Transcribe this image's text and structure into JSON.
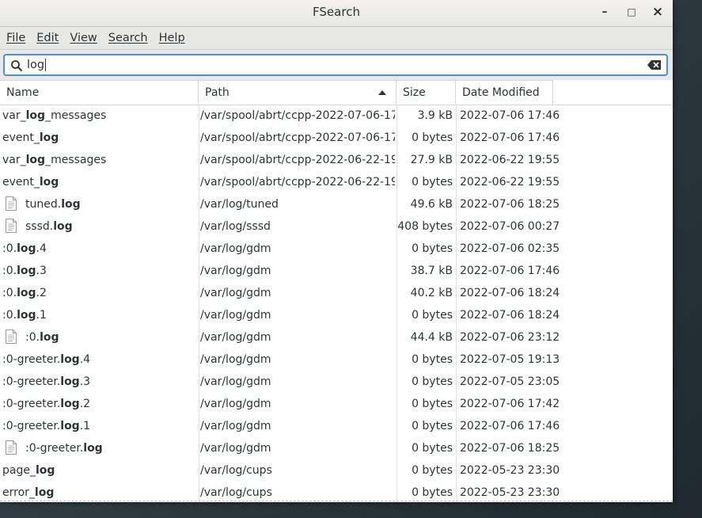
{
  "window": {
    "title": "FSearch",
    "minimize_glyph": "–",
    "maximize_glyph": "□",
    "close_glyph": "×"
  },
  "menu": [
    "File",
    "Edit",
    "View",
    "Search",
    "Help"
  ],
  "search": {
    "value": "log",
    "icon": "search-icon",
    "clear_icon": "clear-icon"
  },
  "columns": [
    "Name",
    "Path",
    "Size",
    "Date Modified"
  ],
  "sort": {
    "column": "Path",
    "direction": "ascending"
  },
  "rows": [
    {
      "icon": false,
      "pre": "var_",
      "match": "log",
      "post": "_messages",
      "path": "/var/spool/abrt/ccpp-2022-07-06-17…",
      "size": "3.9 kB",
      "date": "2022-07-06 17:46"
    },
    {
      "icon": false,
      "pre": "event_",
      "match": "log",
      "post": "",
      "path": "/var/spool/abrt/ccpp-2022-07-06-17…",
      "size": "0 bytes",
      "date": "2022-07-06 17:46"
    },
    {
      "icon": false,
      "pre": "var_",
      "match": "log",
      "post": "_messages",
      "path": "/var/spool/abrt/ccpp-2022-06-22-19…",
      "size": "27.9 kB",
      "date": "2022-06-22 19:55"
    },
    {
      "icon": false,
      "pre": "event_",
      "match": "log",
      "post": "",
      "path": "/var/spool/abrt/ccpp-2022-06-22-19…",
      "size": "0 bytes",
      "date": "2022-06-22 19:55"
    },
    {
      "icon": true,
      "pre": "tuned.",
      "match": "log",
      "post": "",
      "path": "/var/log/tuned",
      "size": "49.6 kB",
      "date": "2022-07-06 18:25"
    },
    {
      "icon": true,
      "pre": "sssd.",
      "match": "log",
      "post": "",
      "path": "/var/log/sssd",
      "size": "408 bytes",
      "date": "2022-07-06 00:27"
    },
    {
      "icon": false,
      "pre": ":0.",
      "match": "log",
      "post": ".4",
      "path": "/var/log/gdm",
      "size": "0 bytes",
      "date": "2022-07-06 02:35"
    },
    {
      "icon": false,
      "pre": ":0.",
      "match": "log",
      "post": ".3",
      "path": "/var/log/gdm",
      "size": "38.7 kB",
      "date": "2022-07-06 17:46"
    },
    {
      "icon": false,
      "pre": ":0.",
      "match": "log",
      "post": ".2",
      "path": "/var/log/gdm",
      "size": "40.2 kB",
      "date": "2022-07-06 18:24"
    },
    {
      "icon": false,
      "pre": ":0.",
      "match": "log",
      "post": ".1",
      "path": "/var/log/gdm",
      "size": "0 bytes",
      "date": "2022-07-06 18:24"
    },
    {
      "icon": true,
      "pre": ":0.",
      "match": "log",
      "post": "",
      "path": "/var/log/gdm",
      "size": "44.4 kB",
      "date": "2022-07-06 23:12"
    },
    {
      "icon": false,
      "pre": ":0-greeter.",
      "match": "log",
      "post": ".4",
      "path": "/var/log/gdm",
      "size": "0 bytes",
      "date": "2022-07-05 19:13"
    },
    {
      "icon": false,
      "pre": ":0-greeter.",
      "match": "log",
      "post": ".3",
      "path": "/var/log/gdm",
      "size": "0 bytes",
      "date": "2022-07-05 23:05"
    },
    {
      "icon": false,
      "pre": ":0-greeter.",
      "match": "log",
      "post": ".2",
      "path": "/var/log/gdm",
      "size": "0 bytes",
      "date": "2022-07-06 17:42"
    },
    {
      "icon": false,
      "pre": ":0-greeter.",
      "match": "log",
      "post": ".1",
      "path": "/var/log/gdm",
      "size": "0 bytes",
      "date": "2022-07-06 17:46"
    },
    {
      "icon": true,
      "pre": ":0-greeter.",
      "match": "log",
      "post": "",
      "path": "/var/log/gdm",
      "size": "0 bytes",
      "date": "2022-07-06 18:25"
    },
    {
      "icon": false,
      "pre": "page_",
      "match": "log",
      "post": "",
      "path": "/var/log/cups",
      "size": "0 bytes",
      "date": "2022-05-23 23:30"
    },
    {
      "icon": false,
      "pre": "error_",
      "match": "log",
      "post": "",
      "path": "/var/log/cups",
      "size": "0 bytes",
      "date": "2022-05-23 23:30"
    }
  ],
  "colors": {
    "accent": "#4a90d9",
    "chrome": "#e8e8e7",
    "text": "#2e3436"
  }
}
